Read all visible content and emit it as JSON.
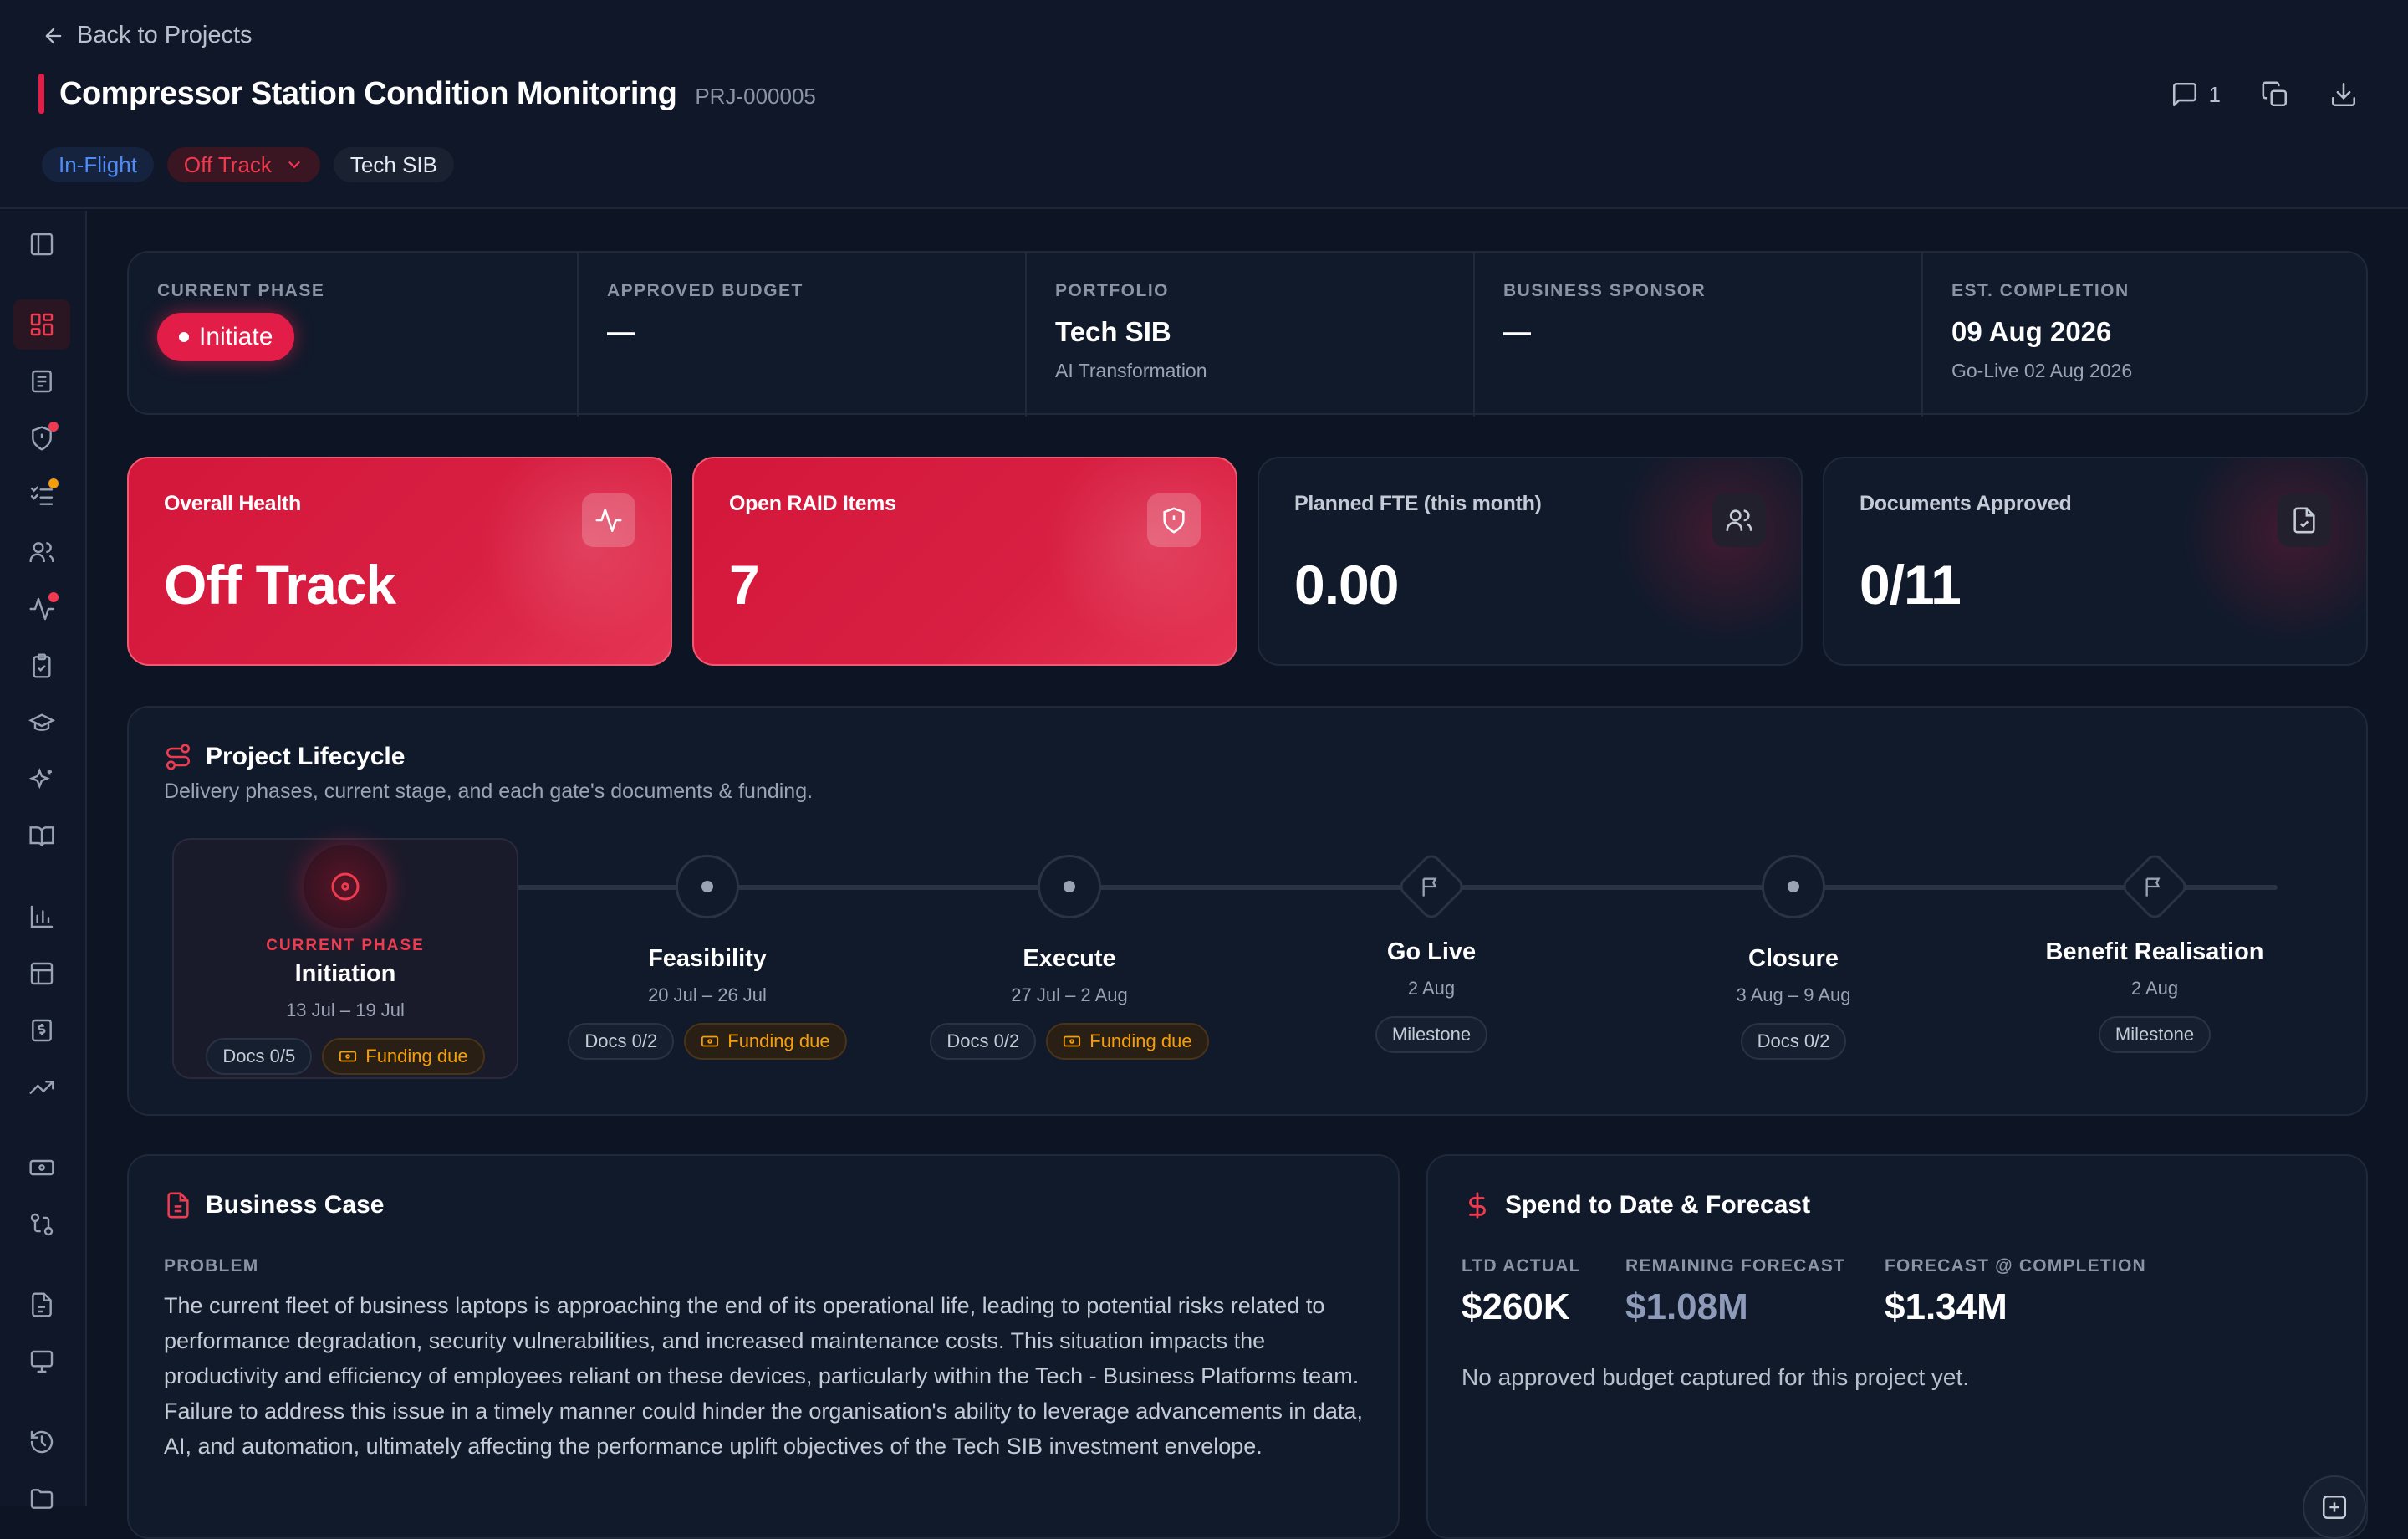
{
  "header": {
    "back_label": "Back to Projects",
    "title": "Compressor Station Condition Monitoring",
    "project_id": "PRJ-000005",
    "tags": {
      "stage": "In-Flight",
      "status": "Off Track",
      "portfolio": "Tech SIB"
    },
    "comment_count": "1"
  },
  "info": {
    "phase_label": "CURRENT PHASE",
    "phase_value": "Initiate",
    "budget_label": "APPROVED BUDGET",
    "budget_value": "—",
    "portfolio_label": "PORTFOLIO",
    "portfolio_value": "Tech SIB",
    "portfolio_sub": "AI Transformation",
    "sponsor_label": "BUSINESS SPONSOR",
    "sponsor_value": "—",
    "completion_label": "EST. COMPLETION",
    "completion_value": "09 Aug 2026",
    "completion_sub": "Go-Live 02 Aug 2026"
  },
  "kpis": [
    {
      "label": "Overall Health",
      "value": "Off Track",
      "icon": "activity-icon"
    },
    {
      "label": "Open RAID Items",
      "value": "7",
      "icon": "shield-alert-icon"
    },
    {
      "label": "Planned FTE (this month)",
      "value": "0.00",
      "icon": "users-icon"
    },
    {
      "label": "Documents Approved",
      "value": "0/11",
      "icon": "file-check-icon"
    }
  ],
  "lifecycle": {
    "title": "Project Lifecycle",
    "subtitle": "Delivery phases, current stage, and each gate's documents & funding.",
    "current_label": "CURRENT PHASE",
    "stages": [
      {
        "name": "Initiation",
        "dates": "13 Jul – 19 Jul",
        "docs": "Docs 0/5",
        "funding": "Funding due"
      },
      {
        "name": "Feasibility",
        "dates": "20 Jul – 26 Jul",
        "docs": "Docs 0/2",
        "funding": "Funding due"
      },
      {
        "name": "Execute",
        "dates": "27 Jul – 2 Aug",
        "docs": "Docs 0/2",
        "funding": "Funding due"
      },
      {
        "name": "Go Live",
        "dates": "2 Aug",
        "docs": "Milestone"
      },
      {
        "name": "Closure",
        "dates": "3 Aug – 9 Aug",
        "docs": "Docs 0/2"
      },
      {
        "name": "Benefit Realisation",
        "dates": "2 Aug",
        "docs": "Milestone"
      }
    ]
  },
  "business_case": {
    "title": "Business Case",
    "problem_label": "PROBLEM",
    "problem_text": "The current fleet of business laptops is approaching the end of its operational life, leading to potential risks related to performance degradation, security vulnerabilities, and increased maintenance costs. This situation impacts the productivity and efficiency of employees reliant on these devices, particularly within the Tech - Business Platforms team. Failure to address this issue in a timely manner could hinder the organisation's ability to leverage advancements in data, AI, and automation, ultimately affecting the performance uplift objectives of the Tech SIB investment envelope."
  },
  "spend": {
    "title": "Spend to Date & Forecast",
    "ltd_label": "LTD ACTUAL",
    "ltd_value": "$260K",
    "remaining_label": "REMAINING FORECAST",
    "remaining_value": "$1.08M",
    "forecast_label": "FORECAST @ COMPLETION",
    "forecast_value": "$1.34M",
    "note": "No approved budget captured for this project yet."
  },
  "colors": {
    "accent": "#e11d48",
    "background": "#0d1525",
    "card": "#111a2b",
    "warning": "#f59e0b",
    "info": "#4f8cf7"
  }
}
